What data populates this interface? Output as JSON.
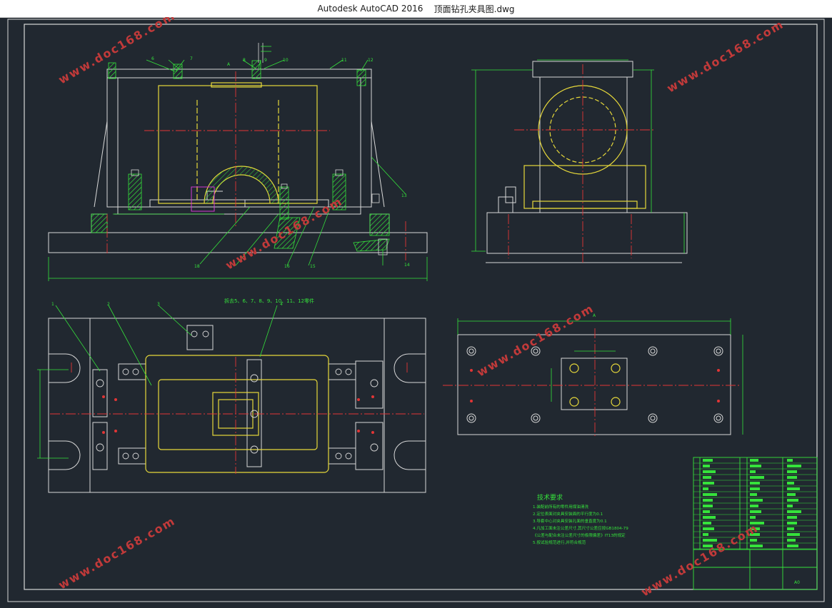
{
  "titlebar": {
    "app": "Autodesk AutoCAD 2016",
    "file": "顶面钻孔夹具图.dwg"
  },
  "drawing": {
    "top_view_note": "拆去5、6、7、8、9、10、11、12零件",
    "tech_title": "技术要求",
    "tech_lines": [
      "1.装配前所有的零件用煤油清洗",
      "2.定位表面对夹具安装面的平行度为0.1",
      "3.导套中心对夹具安装孔面的垂直度为0.1",
      "4.凡加工面未注公差尺寸,其尺寸公差应按GB1804-79",
      "《公差与配合未注公差尺寸的极限偏差》IT13的规定",
      "5.按试验规范进行,并符合规范"
    ],
    "dim_A": "A",
    "balloons_front": [
      "6",
      "7",
      "8",
      "9",
      "10",
      "11",
      "12",
      "13",
      "14",
      "15",
      "16",
      "18"
    ],
    "balloons_top": [
      "1",
      "2",
      "3",
      "4"
    ],
    "watermark": "www.doc168.com",
    "title_block_sheet": "A0"
  },
  "colors": {
    "background": "#212830",
    "geometry": "#d8d8d8",
    "yellow": "#e6d83a",
    "green": "#35e23b",
    "red": "#e23636",
    "magenta": "#d23ad2",
    "watermark": "#c23a3a"
  }
}
